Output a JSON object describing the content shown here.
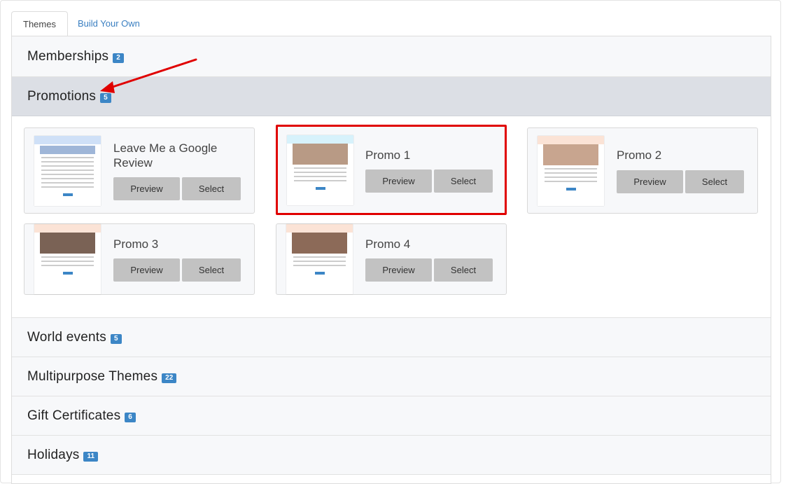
{
  "tabs": [
    {
      "label": "Themes",
      "active": true
    },
    {
      "label": "Build Your Own",
      "active": false
    }
  ],
  "sections": {
    "memberships": {
      "title": "Memberships",
      "count": "2"
    },
    "promotions": {
      "title": "Promotions",
      "count": "5"
    },
    "world_events": {
      "title": "World events",
      "count": "5"
    },
    "multipurpose": {
      "title": "Multipurpose Themes",
      "count": "22"
    },
    "gift_certificates": {
      "title": "Gift Certificates",
      "count": "6"
    },
    "holidays": {
      "title": "Holidays",
      "count": "11"
    }
  },
  "templates": [
    {
      "title": "Leave Me a Google Review",
      "preview_label": "Preview",
      "select_label": "Select"
    },
    {
      "title": "Promo 1",
      "preview_label": "Preview",
      "select_label": "Select"
    },
    {
      "title": "Promo 2",
      "preview_label": "Preview",
      "select_label": "Select"
    },
    {
      "title": "Promo 3",
      "preview_label": "Preview",
      "select_label": "Select"
    },
    {
      "title": "Promo 4",
      "preview_label": "Preview",
      "select_label": "Select"
    }
  ],
  "colors": {
    "badge": "#3c86c6",
    "highlight": "#e00000",
    "active_section": "#dcdfe5",
    "link": "#3a7fc1"
  },
  "icons": {
    "annotation": "red-arrow-icon"
  }
}
